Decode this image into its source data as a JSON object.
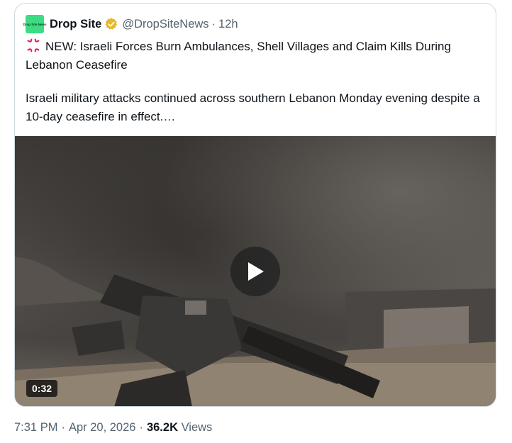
{
  "quote": {
    "author": {
      "avatar_text": "Drop Site News",
      "display_name": "Drop Site",
      "handle": "@DropSiteNews",
      "verified_icon": "verified-badge-gold"
    },
    "separator": "·",
    "time_ago": "12h",
    "headline_icon": "anger-symbol-icon",
    "headline": "NEW: Israeli Forces Burn Ambulances, Shell Villages and Claim Kills During Lebanon Ceasefire",
    "text": "Israeli military attacks continued across southern Lebanon Monday evening despite a 10-day ceasefire in effect.…",
    "media": {
      "type": "video",
      "duration": "0:32",
      "play_icon": "play-icon"
    }
  },
  "meta": {
    "time": "7:31 PM",
    "date": "Apr 20, 2026",
    "views_count": "36.2K",
    "views_label": "Views",
    "separator": "·"
  }
}
